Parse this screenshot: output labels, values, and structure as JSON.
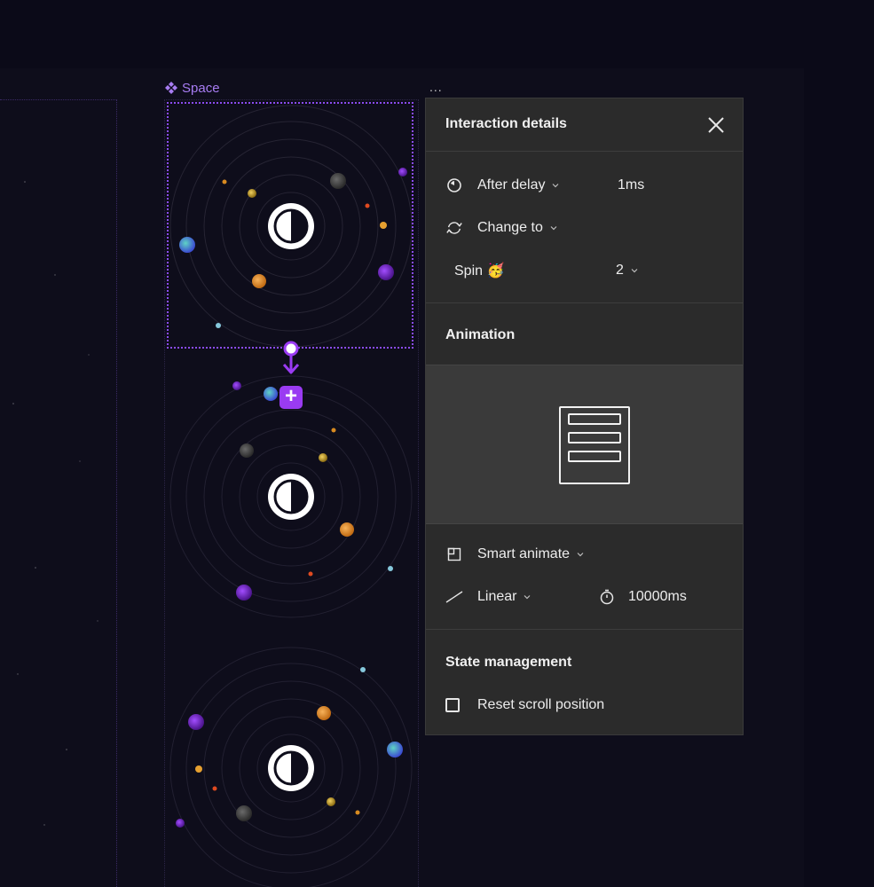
{
  "canvas": {
    "frame_label": "Space",
    "more": "...",
    "add_symbol": "+"
  },
  "panel": {
    "title": "Interaction details",
    "trigger": {
      "label": "After delay",
      "value": "1ms"
    },
    "action": {
      "label": "Change to"
    },
    "destination": {
      "label": "Spin 🥳",
      "value": "2"
    },
    "animation": {
      "title": "Animation",
      "type_label": "Smart animate",
      "easing_label": "Linear",
      "duration": "10000ms"
    },
    "state": {
      "title": "State management",
      "reset_scroll_label": "Reset scroll position",
      "reset_scroll_checked": false
    }
  },
  "icons": {
    "frame": "component-icon",
    "close": "close-icon",
    "delay": "timer-icon",
    "action": "swap-icon",
    "animate": "smart-animate-icon",
    "easing": "easing-curve-icon",
    "duration": "stopwatch-icon"
  },
  "colors": {
    "accent": "#9a3bf2",
    "panel_bg": "#2b2b2b",
    "canvas_bg": "#0b0a18"
  }
}
